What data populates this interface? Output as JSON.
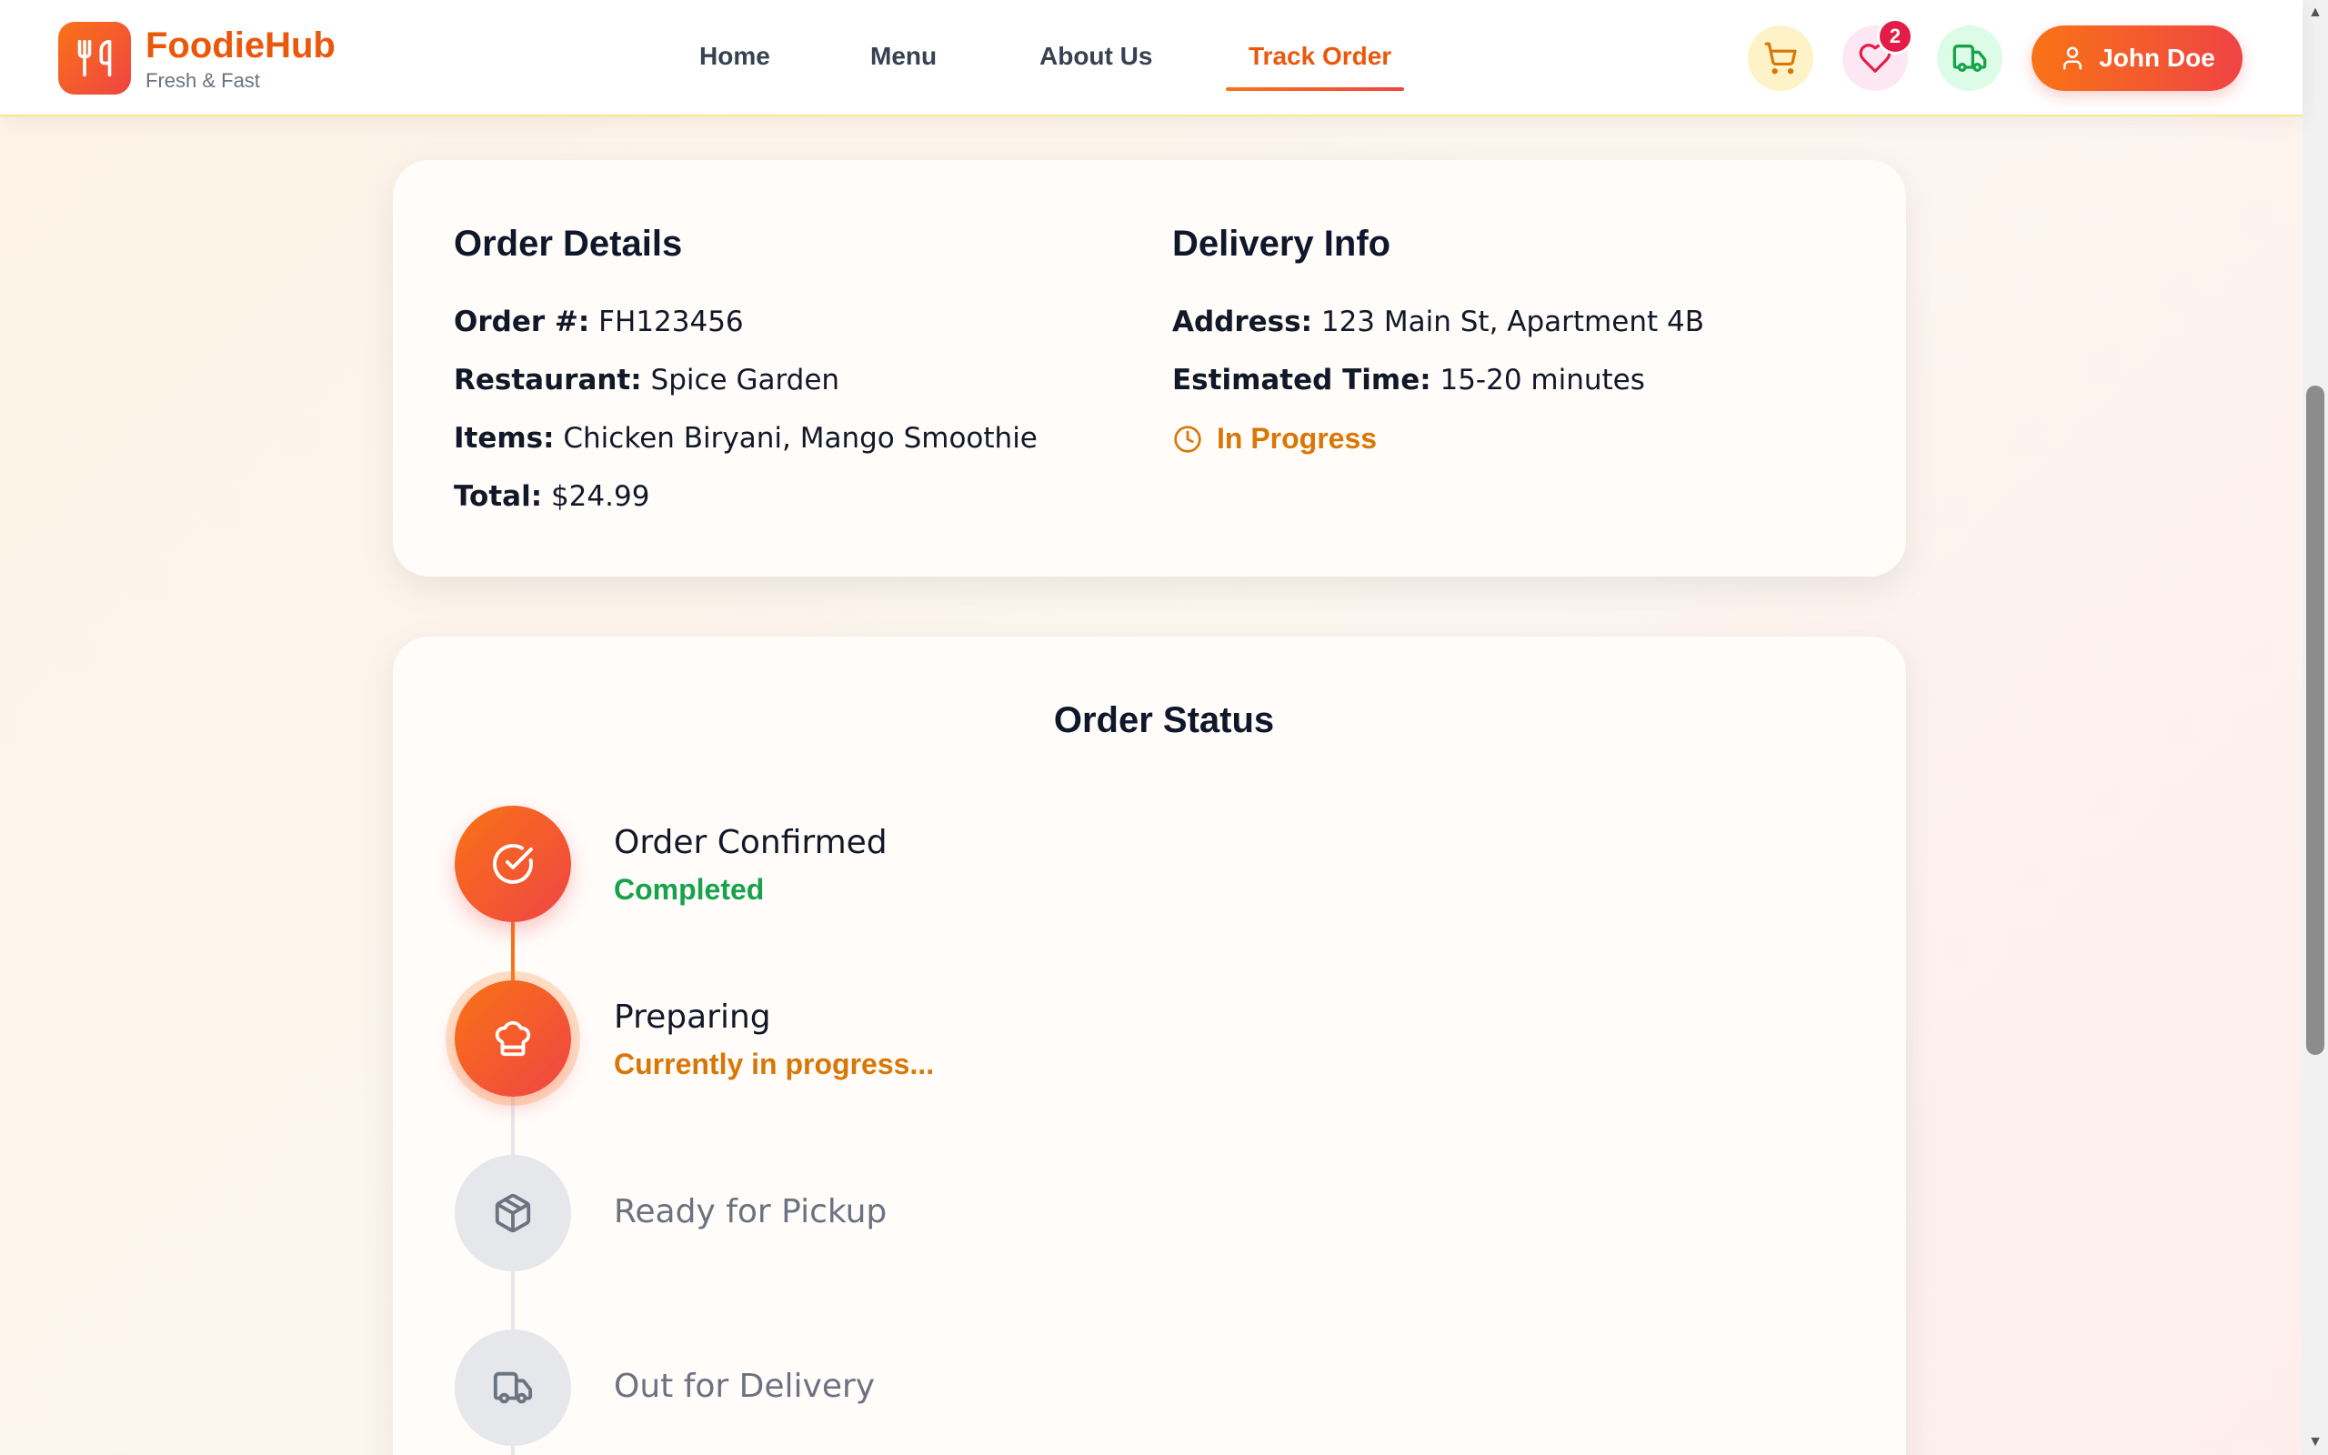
{
  "header": {
    "brand_name": "FoodieHub",
    "brand_tagline": "Fresh & Fast",
    "nav": [
      {
        "label": "Home"
      },
      {
        "label": "Menu"
      },
      {
        "label": "About Us"
      },
      {
        "label": "Track Order",
        "active": true
      }
    ],
    "favorites_count": "2",
    "user_name": "John Doe"
  },
  "order_details": {
    "title": "Order Details",
    "order_number_label": "Order #:",
    "order_number": "FH123456",
    "restaurant_label": "Restaurant:",
    "restaurant": "Spice Garden",
    "items_label": "Items:",
    "items": "Chicken Biryani, Mango Smoothie",
    "total_label": "Total:",
    "total": "$24.99"
  },
  "delivery_info": {
    "title": "Delivery Info",
    "address_label": "Address:",
    "address": "123 Main St, Apartment 4B",
    "eta_label": "Estimated Time:",
    "eta": "15-20 minutes",
    "status": "In Progress"
  },
  "order_status": {
    "title": "Order Status",
    "steps": [
      {
        "title": "Order Confirmed",
        "subtitle": "Completed",
        "state": "done",
        "icon": "check-circle-icon"
      },
      {
        "title": "Preparing",
        "subtitle": "Currently in progress...",
        "state": "active",
        "icon": "chef-hat-icon"
      },
      {
        "title": "Ready for Pickup",
        "subtitle": "",
        "state": "pending",
        "icon": "package-icon"
      },
      {
        "title": "Out for Delivery",
        "subtitle": "",
        "state": "pending",
        "icon": "truck-icon"
      }
    ]
  },
  "colors": {
    "accent_orange": "#f97316",
    "accent_red": "#ef4444",
    "success_green": "#16a34a",
    "progress_amber": "#d97706"
  }
}
